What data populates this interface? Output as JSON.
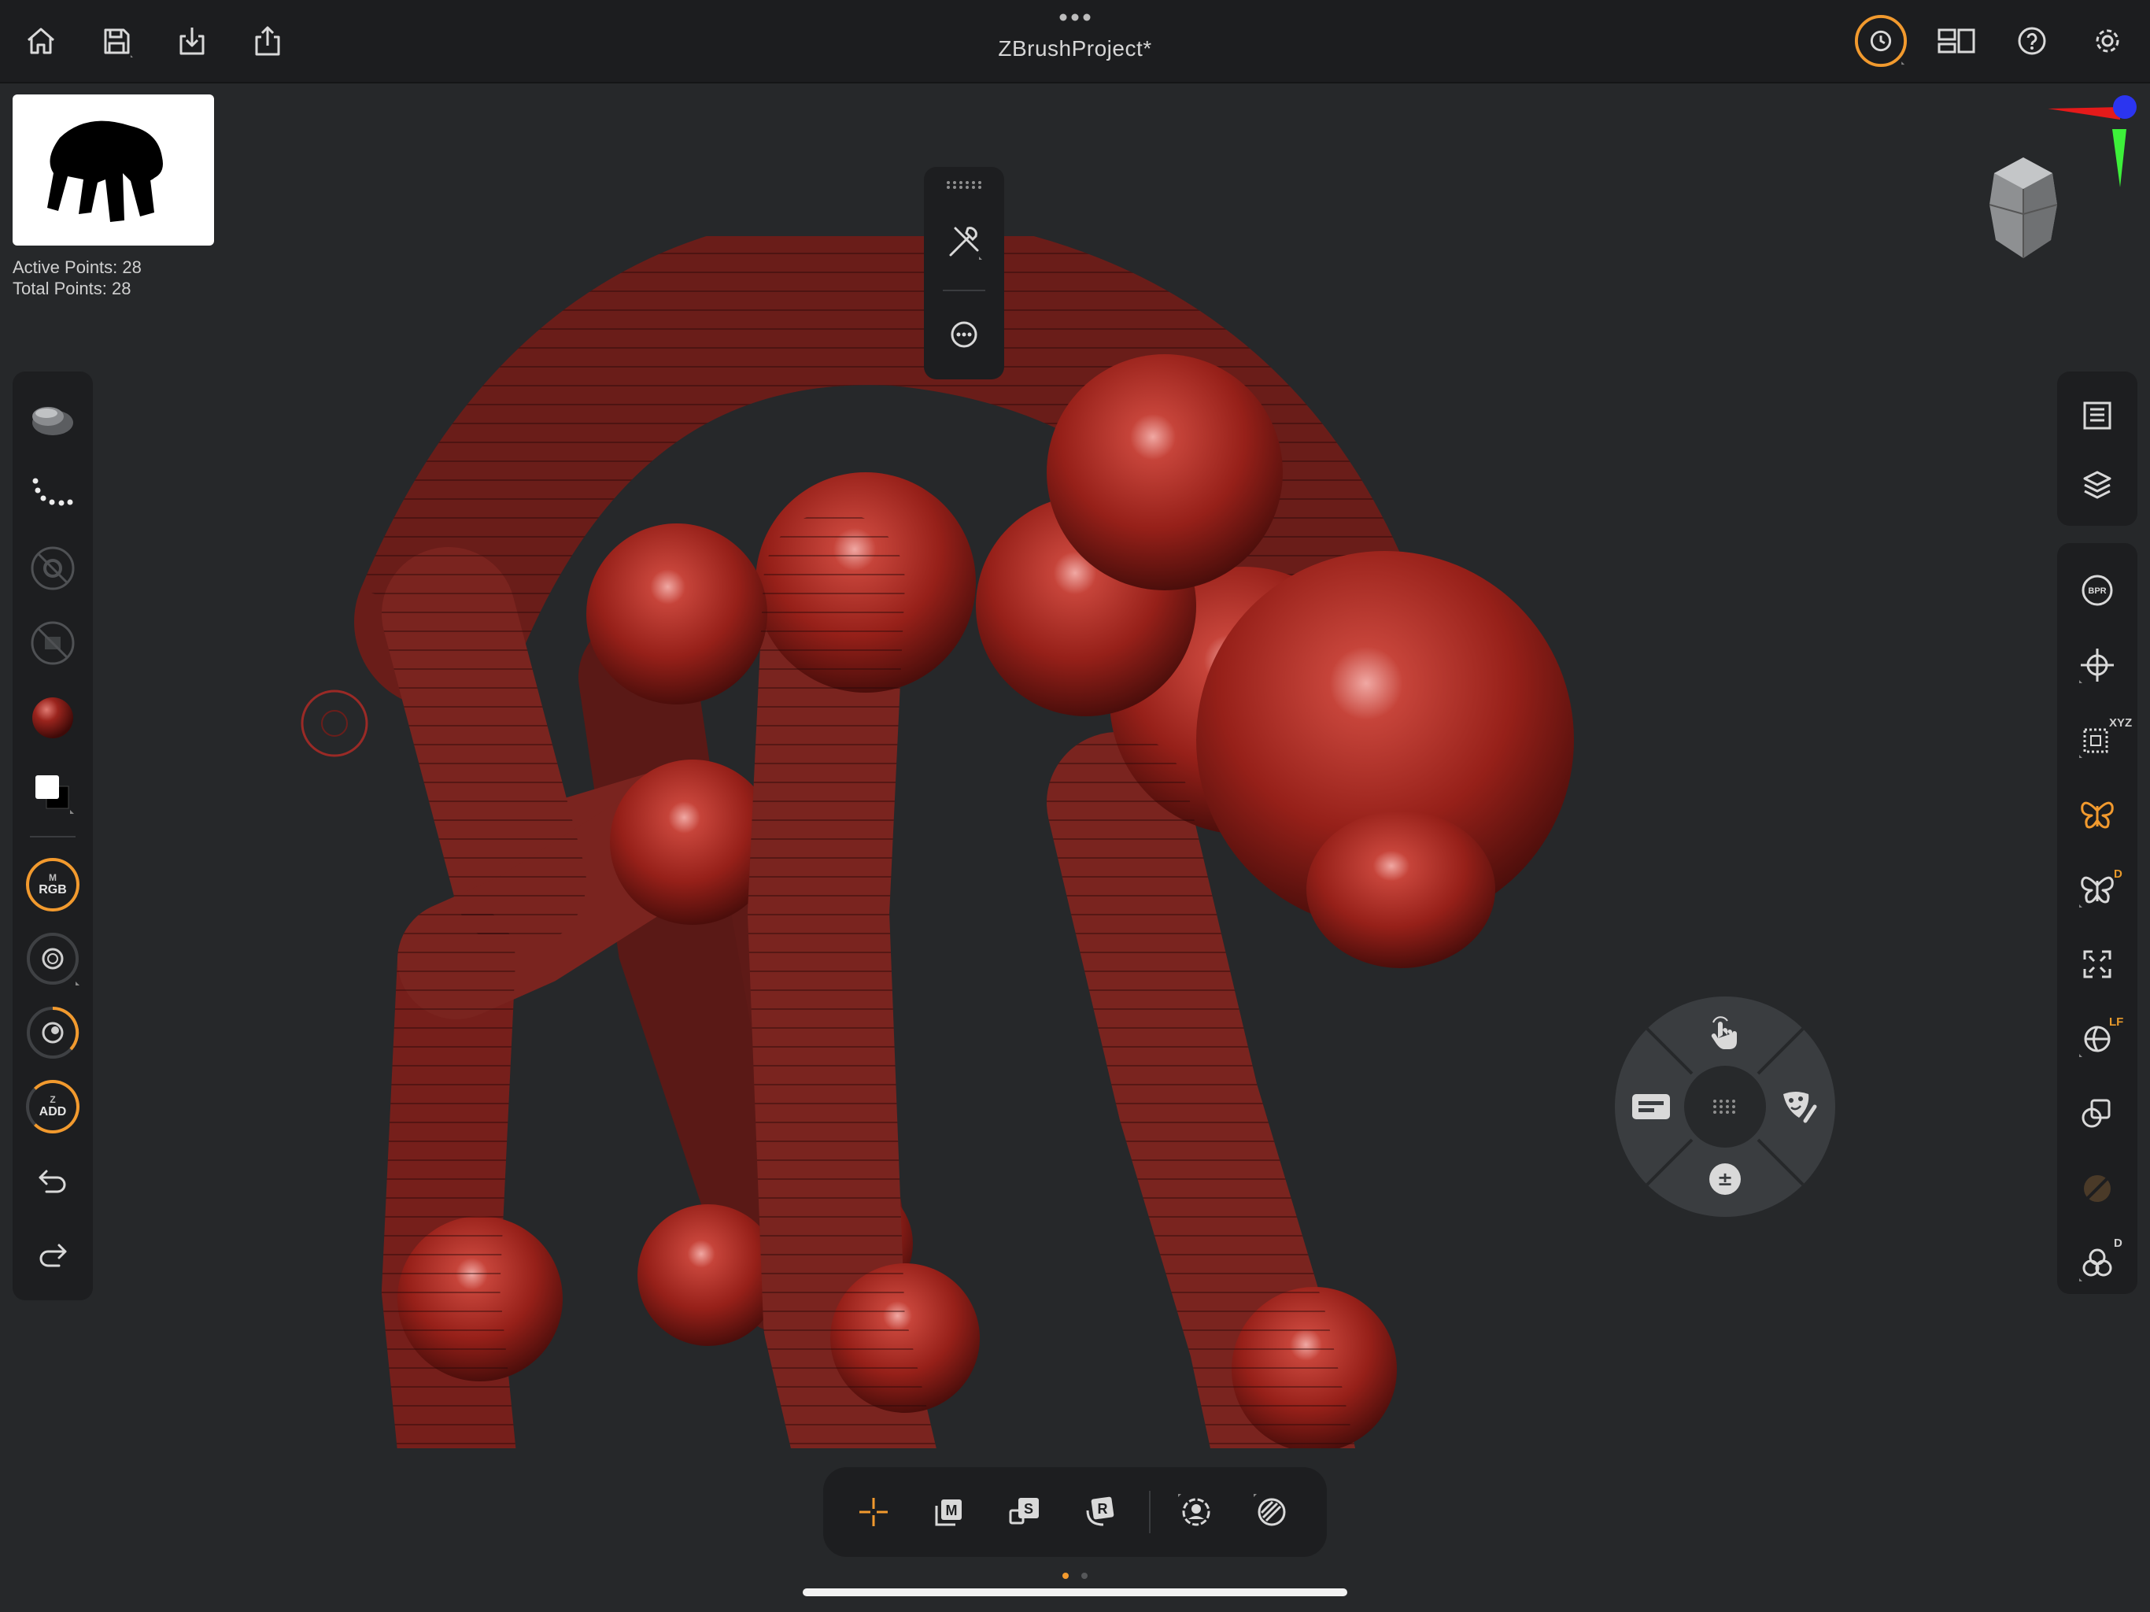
{
  "app": {
    "title": "ZBrushProject*",
    "accent_color": "#f29a2e",
    "model_color": "#9b2620"
  },
  "topbar": {
    "left_icons": [
      "home-icon",
      "save-icon",
      "import-icon",
      "share-icon"
    ],
    "right_icons": [
      "history-icon",
      "layout-icon",
      "help-icon",
      "settings-icon"
    ]
  },
  "info": {
    "active_points": "Active Points: 28",
    "total_points": "Total Points: 28"
  },
  "left_toolbar": {
    "items": [
      "brush-icon",
      "stroke-icon",
      "alpha-icon",
      "texture-icon",
      "material-sphere-icon",
      "color-swatch-icon"
    ],
    "rgb_small": "M",
    "rgb_big": "RGB",
    "zadd_small": "Z",
    "zadd_big": "ADD",
    "bottom_items": [
      "draw-size-icon",
      "focal-shift-icon",
      "undo-icon",
      "redo-icon"
    ]
  },
  "floating_menu": {
    "items": [
      "tool-icon",
      "more-icon"
    ]
  },
  "right_toolbar_top": {
    "items": [
      "sub-palette-icon",
      "layers-icon"
    ]
  },
  "right_toolbar": {
    "bpr_label": "BPR",
    "xyz_badge": "XYZ",
    "d_badge": "D",
    "lf_badge": "LF",
    "d2_badge": "D",
    "items": [
      "bpr-icon",
      "floor-grid-icon",
      "symmetry-icon",
      "symmetry-d-icon",
      "frame-icon",
      "polyframe-icon",
      "transparency-icon",
      "solo-icon",
      "flat-material-icon",
      "blend-icon"
    ]
  },
  "radial_menu": {
    "items": [
      "gesture-icon",
      "mask-icon",
      "add-subtract-icon",
      "text-icon",
      "grid-icon"
    ],
    "center_label": "±"
  },
  "bottom_toolbar": {
    "items": [
      "transform-icon",
      "move-icon",
      "scale-icon",
      "rotate-icon",
      "gizmo-icon",
      "edit-icon"
    ],
    "move_label": "M",
    "scale_label": "S",
    "rotate_label": "R"
  }
}
